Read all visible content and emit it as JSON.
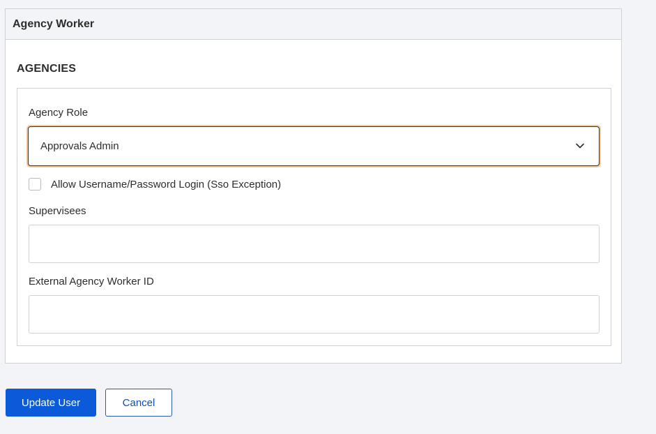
{
  "card": {
    "header_title": "Agency Worker",
    "section_title": "AGENCIES"
  },
  "form": {
    "agency_role": {
      "label": "Agency Role",
      "selected_value": "Approvals Admin"
    },
    "sso_exception": {
      "label": "Allow Username/Password Login (Sso Exception)",
      "checked": false
    },
    "supervisees": {
      "label": "Supervisees",
      "value": ""
    },
    "external_worker_id": {
      "label": "External Agency Worker ID",
      "value": ""
    }
  },
  "actions": {
    "update_label": "Update User",
    "cancel_label": "Cancel"
  },
  "colors": {
    "primary": "#0b5ad9",
    "focus_ring": "#e8953a",
    "page_background": "#f3f4f7"
  }
}
